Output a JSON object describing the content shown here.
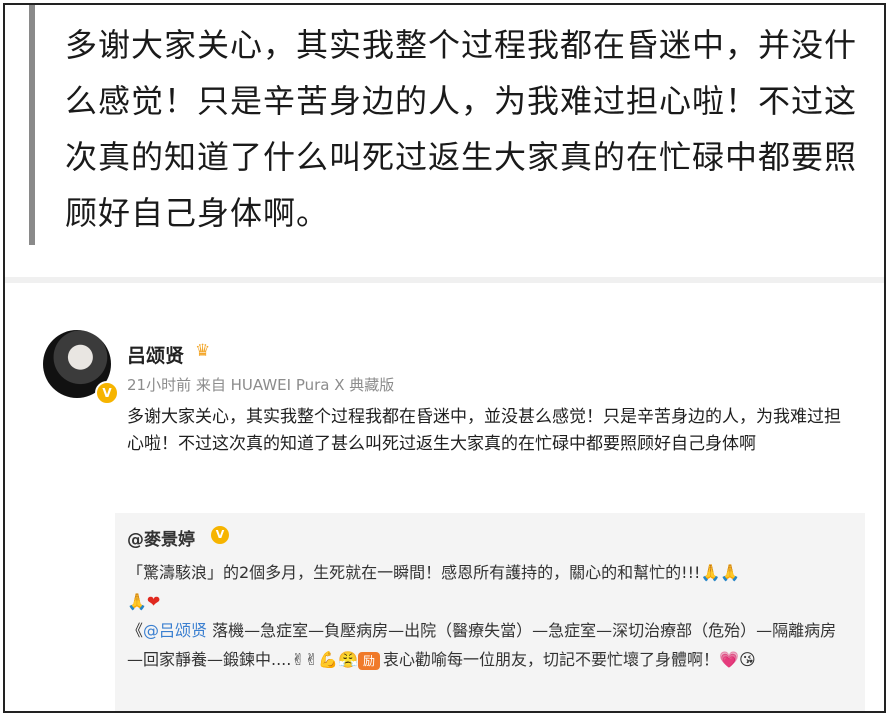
{
  "quote": {
    "text": "多谢大家关心，其实我整个过程我都在昏迷中，并没什么感觉！只是辛苦身边的人，为我难过担心啦！不过这次真的知道了什么叫死过返生大家真的在忙碌中都要照顾好自己身体啊。"
  },
  "post": {
    "username": "吕颂贤",
    "crown_icon": "crown-icon",
    "meta": "21小时前 来自 HUAWEI Pura X 典藏版",
    "body": "多谢大家关心，其实我整个过程我都在昏迷中，並没甚么感觉！只是辛苦身边的人，为我难过担心啦！不过这次真的知道了甚么叫死过返生大家真的在忙碌中都要照顾好自己身体啊",
    "verified_badge": "V"
  },
  "repost": {
    "username": "@麥景婷",
    "verified_badge": "V",
    "line1": "「驚濤駭浪」的2個多月，生死就在一瞬間！感恩所有護持的，關心的和幫忙的!!!",
    "prefix": "《",
    "mention": "@吕颂贤",
    "line2": " 落機—急症室—負壓病房—出院（醫療失當）—急症室—深切治療部（危殆）—隔離病房—回家靜養—鍛鍊中....",
    "line3": "衷心勸喻每一位朋友，切記不要忙壞了身體啊！",
    "emojis": {
      "pray1": "🙏",
      "pray2": "🙏",
      "pray3": "🙏",
      "heart": "❤",
      "victory1": "✌",
      "victory2": "✌",
      "muscle": "💪",
      "face": "😤",
      "tag": "励",
      "hearts": "💗",
      "wink": "😘"
    }
  }
}
